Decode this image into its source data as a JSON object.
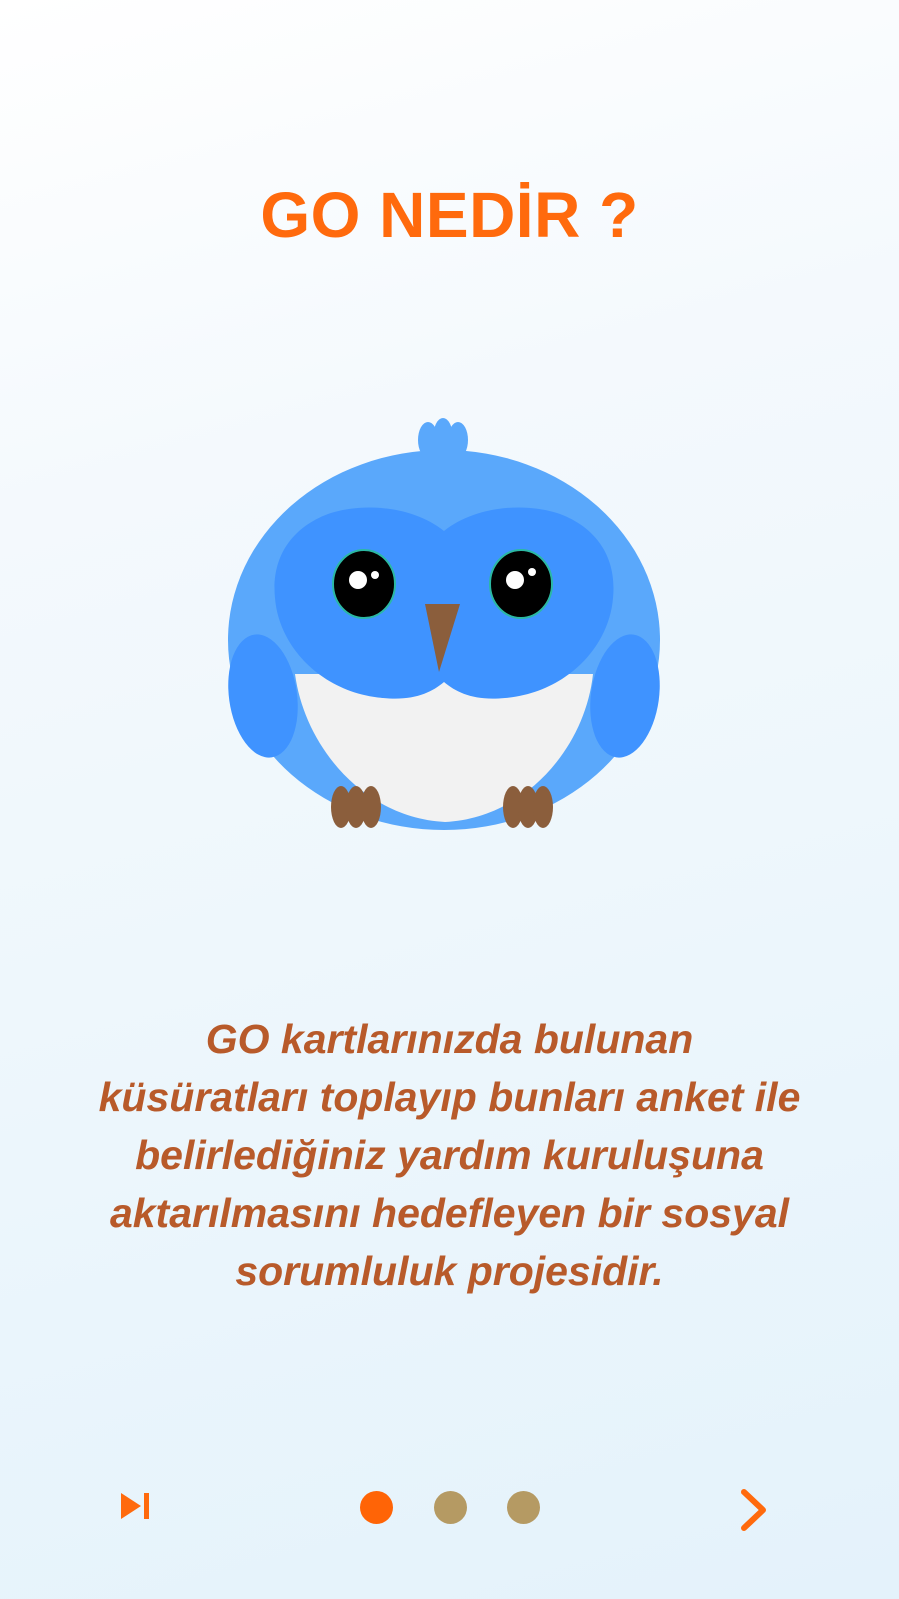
{
  "onboarding": {
    "title": "GO NEDİR ?",
    "description": "GO  kartlarınızda bulunan\nküsüratları toplayıp bunları  anket ile\nbelirlediğiniz yardım kuruluşuna\naktarılmasını hedefleyen bir sosyal\nsorumluluk projesidir.",
    "mascot": "blue-owl-illustration",
    "page_indicator": {
      "total": 3,
      "current": 1
    }
  },
  "navigation": {
    "skip_icon": "skip-next-icon",
    "next_icon": "chevron-right-icon"
  },
  "colors": {
    "accent": "#ff6a0d",
    "text": "#b85a2a",
    "dot_active": "#ff6406",
    "dot_inactive": "#b59a63",
    "owl_body": "#5aa8fb",
    "owl_face": "#3f93ff"
  }
}
